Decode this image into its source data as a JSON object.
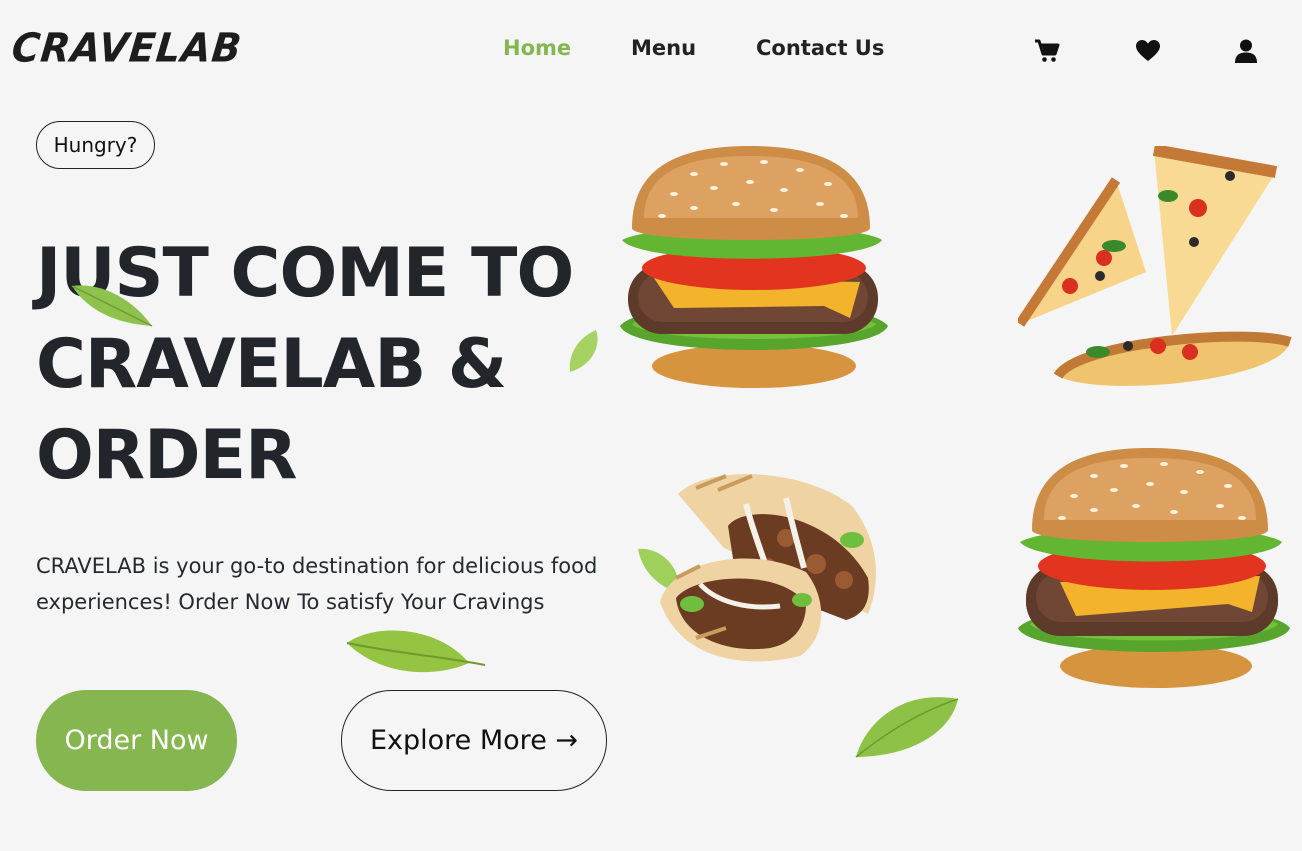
{
  "brand": {
    "logo_text": "CRAVELAB"
  },
  "nav": {
    "links": [
      {
        "label": "Home",
        "active": true
      },
      {
        "label": "Menu",
        "active": false
      },
      {
        "label": "Contact Us",
        "active": false
      }
    ],
    "icons": [
      "cart-icon",
      "heart-icon",
      "user-icon"
    ]
  },
  "hero": {
    "badge": "Hungry?",
    "headline": "JUST COME TO CRAVELAB & ORDER",
    "description": "CRAVELAB is your go-to destination for delicious food experiences! Order Now To satisfy Your Cravings",
    "primary_button": "Order Now",
    "secondary_button": "Explore More →"
  },
  "images": [
    "burger-image",
    "pizza-slices-image",
    "wrap-image",
    "burger-image-2"
  ],
  "colors": {
    "accent": "#85b650",
    "text": "#212529",
    "background": "#f5f5f6"
  }
}
